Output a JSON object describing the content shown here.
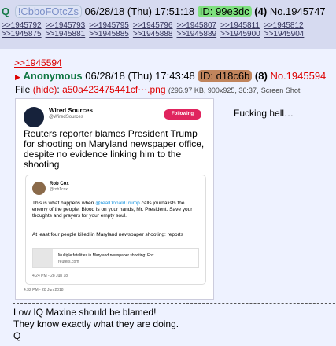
{
  "top_post": {
    "letter": "Q",
    "tripcode": "!CbboFOtcZs",
    "datetime": "06/28/18 (Thu) 17:51:18",
    "id_label": "ID: 99e3dc",
    "reply_count": "(4)",
    "post_number": "No.1945747",
    "backlinks": [
      ">>1945792",
      ">>1945793",
      ">>1945795",
      ">>1945796",
      ">>1945807",
      ">>1945811",
      ">>1945812",
      ">>1945875",
      ">>1945881",
      ">>1945885",
      ">>1945888",
      ">>1945889",
      ">>1945900",
      ">>1945904"
    ]
  },
  "quote_link": ">>1945594",
  "reply": {
    "name": "Anonymous",
    "datetime": "06/28/18 (Thu) 17:43:48",
    "id_label": "ID: d18c6b",
    "reply_count": "(8)",
    "post_number": "No.1945594",
    "file_label": "File",
    "hide": "(hide)",
    "file_name": "a50a423475441cf⋯.png",
    "file_meta": "(296.97 KB, 900x925, 36:37,",
    "screen_shot": "Screen Shot",
    "message": "Fucking hell…",
    "tweet": {
      "name": "Wired Sources",
      "handle": "@WiredSources",
      "follow": "Following",
      "text": "Reuters reporter blames President Trump for shooting on Maryland newspaper office, despite no evidence linking him to the shooting",
      "time": "4:32 PM - 28 Jun 2018",
      "quoted": {
        "name": "Rob Cox",
        "handle": "@rob1cox",
        "body_before": "This is what happens when ",
        "mention": "@realDonaldTrump",
        "body_after": " calls journalists the enemy of the people. Blood is on your hands, Mr. President. Save your thoughts and prayers for your empty soul.",
        "body2": "At least four people killed in Maryland newspaper shooting: reports",
        "card_title": "Multiple fatalities in Maryland newspaper shooting: Fox",
        "card_domain": "reuters.com",
        "time": "4:24 PM - 28 Jun 18"
      }
    }
  },
  "footer": {
    "line1": "Low IQ Maxine should be blamed!",
    "line2": "They know exactly what they are doing.",
    "signature": "Q"
  }
}
